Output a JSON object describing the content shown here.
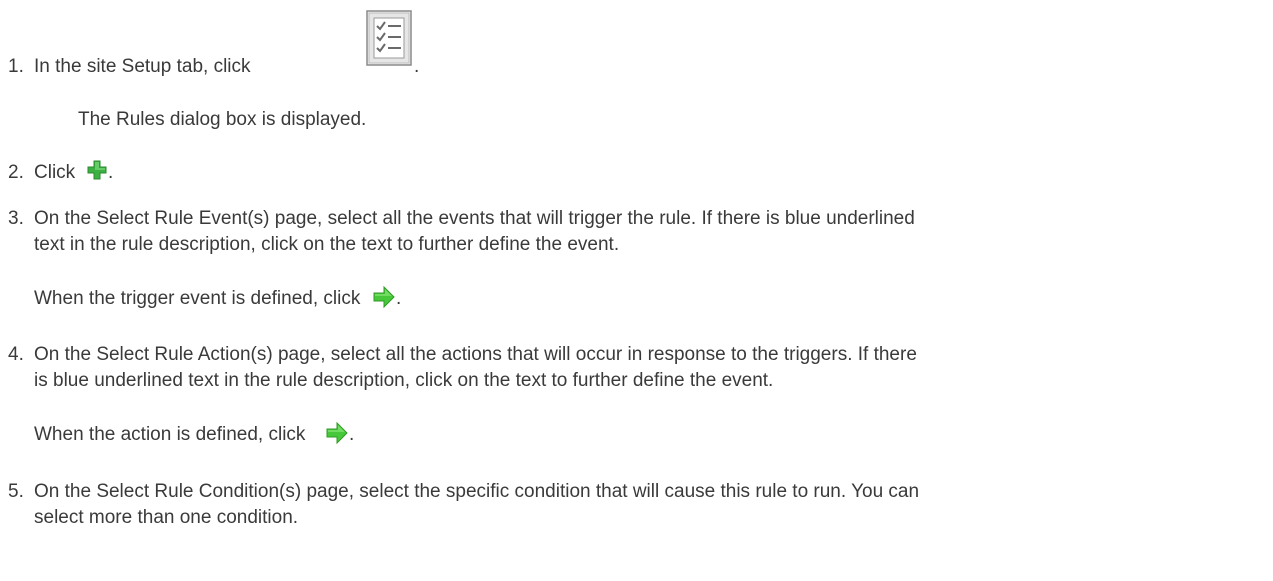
{
  "steps": [
    {
      "number": "1.",
      "text_before_icon": "In the site Setup tab, click",
      "text_after_icon": ".",
      "icon": "rules-checklist-icon",
      "result": "The Rules dialog box is displayed."
    },
    {
      "number": "2.",
      "text_before_icon": "Click",
      "text_after_icon": ".",
      "icon": "add-plus-icon"
    },
    {
      "number": "3.",
      "line1": "On the Select Rule Event(s) page, select all the events that will trigger the rule. If there is blue underlined",
      "line2": "text in the rule description, click on the text to further define the event.",
      "followup_before_icon": "When the trigger event is defined, click",
      "followup_after_icon": ".",
      "icon": "next-arrow-icon"
    },
    {
      "number": "4.",
      "line1": "On the Select Rule Action(s) page, select all the actions that will occur in response to the triggers. If there",
      "line2": "is blue underlined text in the rule description, click on the text to further define the event.",
      "followup_before_icon": "When the action is defined, click",
      "followup_after_icon": ".",
      "icon": "next-arrow-icon"
    },
    {
      "number": "5.",
      "line1": "On the Select Rule Condition(s) page, select the specific condition that will cause this rule to run. You can",
      "line2": "select more than one condition."
    }
  ],
  "colors": {
    "text": "#3a3a3a",
    "plus_green": "#3cb043",
    "arrow_green": "#46c83a"
  }
}
